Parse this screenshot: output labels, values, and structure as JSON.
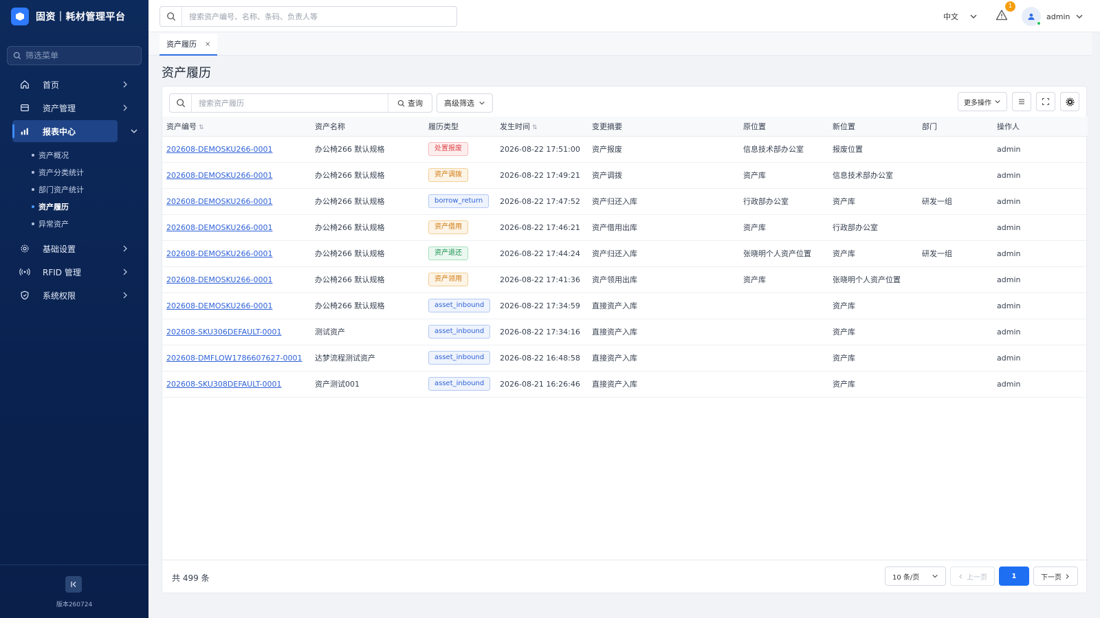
{
  "brand": {
    "title": "固资｜耗材管理平台"
  },
  "sidebar": {
    "filter_placeholder": "筛选菜单",
    "items": [
      {
        "label": "首页",
        "icon": "home-icon"
      },
      {
        "label": "资产管理",
        "icon": "box-icon"
      },
      {
        "label": "报表中心",
        "icon": "chart-icon"
      },
      {
        "label": "基础设置",
        "icon": "gear-icon"
      },
      {
        "label": "RFID 管理",
        "icon": "rfid-icon"
      },
      {
        "label": "系统权限",
        "icon": "shield-icon"
      }
    ],
    "sub_items": [
      "资产概况",
      "资产分类统计",
      "部门资产统计",
      "资产履历",
      "异常资产"
    ],
    "version": "版本260724"
  },
  "header": {
    "search_placeholder": "搜索资产编号、名称、条码、负责人等",
    "lang": "中文",
    "alert_count": "1",
    "user": "admin"
  },
  "tabs": [
    {
      "label": "资产履历",
      "close": "×"
    }
  ],
  "page": {
    "title": "资产履历"
  },
  "toolbar": {
    "search_placeholder": "搜索资产履历",
    "query_label": "查询",
    "advanced_label": "高级筛选",
    "more_ops_label": "更多操作"
  },
  "table": {
    "columns": [
      "资产编号",
      "资产名称",
      "履历类型",
      "发生时间",
      "变更摘要",
      "原位置",
      "新位置",
      "部门",
      "操作人"
    ],
    "rows": [
      {
        "code": "202608-DEMOSKU266-0001",
        "name": "办公椅266 默认规格",
        "type": "处置报废",
        "type_color": "#e0464b",
        "time": "2026-08-22 17:51:00",
        "summary": "资产报废",
        "from": "信息技术部办公室",
        "to": "报废位置",
        "dept": "",
        "operator": "admin"
      },
      {
        "code": "202608-DEMOSKU266-0001",
        "name": "办公椅266 默认规格",
        "type": "资产调拨",
        "type_color": "#d07a12",
        "time": "2026-08-22 17:49:21",
        "summary": "资产调拨",
        "from": "资产库",
        "to": "信息技术部办公室",
        "dept": "",
        "operator": "admin"
      },
      {
        "code": "202608-DEMOSKU266-0001",
        "name": "办公椅266 默认规格",
        "type": "borrow_return",
        "type_color": "#2f62d8",
        "time": "2026-08-22 17:47:52",
        "summary": "资产归还入库",
        "from": "行政部办公室",
        "to": "资产库",
        "dept": "研发一组",
        "operator": "admin"
      },
      {
        "code": "202608-DEMOSKU266-0001",
        "name": "办公椅266 默认规格",
        "type": "资产借用",
        "type_color": "#d07a12",
        "time": "2026-08-22 17:46:21",
        "summary": "资产借用出库",
        "from": "资产库",
        "to": "行政部办公室",
        "dept": "",
        "operator": "admin"
      },
      {
        "code": "202608-DEMOSKU266-0001",
        "name": "办公椅266 默认规格",
        "type": "资产退还",
        "type_color": "#18914e",
        "time": "2026-08-22 17:44:24",
        "summary": "资产归还入库",
        "from": "张晓明个人资产位置",
        "to": "资产库",
        "dept": "研发一组",
        "operator": "admin"
      },
      {
        "code": "202608-DEMOSKU266-0001",
        "name": "办公椅266 默认规格",
        "type": "资产领用",
        "type_color": "#d07a12",
        "time": "2026-08-22 17:41:36",
        "summary": "资产领用出库",
        "from": "资产库",
        "to": "张晓明个人资产位置",
        "dept": "",
        "operator": "admin"
      },
      {
        "code": "202608-DEMOSKU266-0001",
        "name": "办公椅266 默认规格",
        "type": "asset_inbound",
        "type_color": "#2f62d8",
        "time": "2026-08-22 17:34:59",
        "summary": "直接资产入库",
        "from": "",
        "to": "资产库",
        "dept": "",
        "operator": "admin"
      },
      {
        "code": "202608-SKU306DEFAULT-0001",
        "name": "测试资产",
        "type": "asset_inbound",
        "type_color": "#2f62d8",
        "time": "2026-08-22 17:34:16",
        "summary": "直接资产入库",
        "from": "",
        "to": "资产库",
        "dept": "",
        "operator": "admin"
      },
      {
        "code": "202608-DMFLOW1786607627-0001",
        "name": "达梦流程测试资产",
        "type": "asset_inbound",
        "type_color": "#2f62d8",
        "time": "2026-08-22 16:48:58",
        "summary": "直接资产入库",
        "from": "",
        "to": "资产库",
        "dept": "",
        "operator": "admin"
      },
      {
        "code": "202608-SKU308DEFAULT-0001",
        "name": "资产测试001",
        "type": "asset_inbound",
        "type_color": "#2f62d8",
        "time": "2026-08-21 16:26:46",
        "summary": "直接资产入库",
        "from": "",
        "to": "资产库",
        "dept": "",
        "operator": "admin"
      }
    ]
  },
  "footer": {
    "total": "共 499 条",
    "page_size": "10 条/页",
    "prev": "上一页",
    "current_page": "1",
    "next": "下一页"
  }
}
